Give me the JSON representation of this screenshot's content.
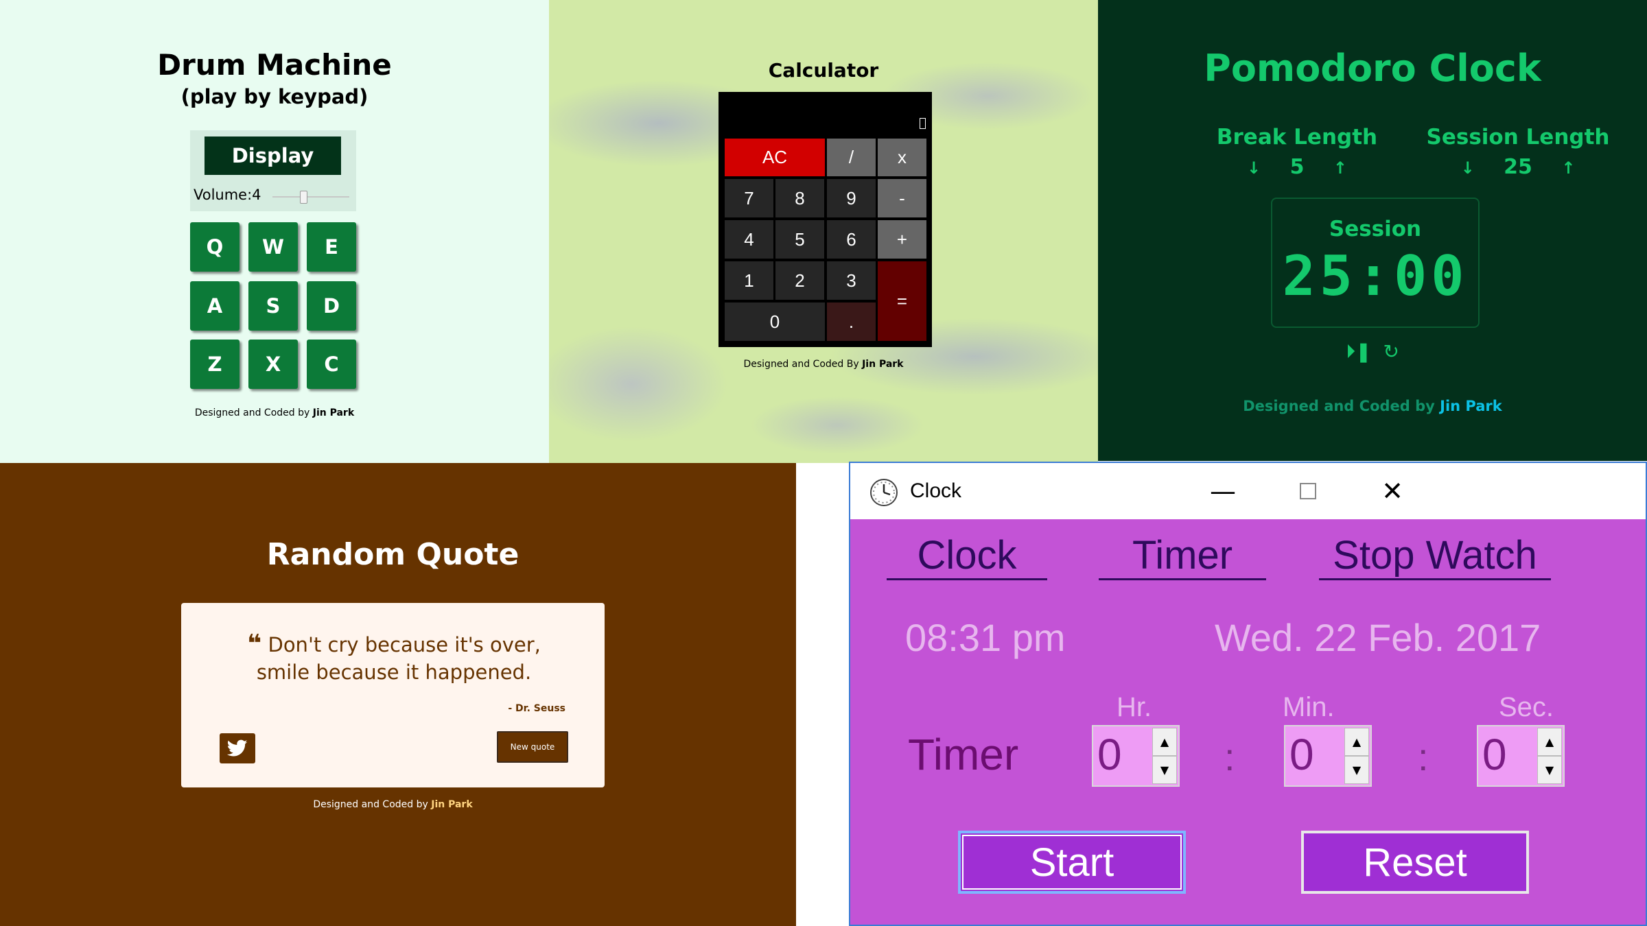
{
  "drum_machine": {
    "title": "Drum Machine",
    "subtitle": "(play by keypad)",
    "display_label": "Display",
    "volume_label": "Volume:4",
    "volume_level": 0.4,
    "pads": [
      "Q",
      "W",
      "E",
      "A",
      "S",
      "D",
      "Z",
      "X",
      "C"
    ],
    "credit_prefix": "Designed and Coded by",
    "credit_name": "Jin Park",
    "colors": {
      "background": "#e8fcf1",
      "pad": "#0c7a38",
      "display": "#033319"
    }
  },
  "calculator": {
    "title": "Calculator",
    "keys": {
      "ac": "AC",
      "divide": "/",
      "multiply": "x",
      "seven": "7",
      "eight": "8",
      "nine": "9",
      "minus": "-",
      "four": "4",
      "five": "5",
      "six": "6",
      "plus": "+",
      "one": "1",
      "two": "2",
      "three": "3",
      "equals": "=",
      "zero": "0",
      "decimal": "."
    },
    "credit_prefix": "Designed and Coded By",
    "credit_name": "Jin Park",
    "colors": {
      "ac": "#d20000",
      "operator": "#666666",
      "equals": "#620000",
      "digit": "#262626"
    }
  },
  "pomodoro": {
    "title": "Pomodoro Clock",
    "break_label": "Break Length",
    "break_value": "5",
    "session_label": "Session Length",
    "session_value": "25",
    "timer_label": "Session",
    "timer_value": "25:00",
    "down_icon": "arrow-down-icon",
    "up_icon": "arrow-up-icon",
    "credit_prefix": "Designed and Coded by",
    "credit_name": "Jin Park",
    "colors": {
      "background": "#03301b",
      "accent": "#14c96c"
    }
  },
  "random_quote": {
    "title": "Random Quote",
    "quote": "Don't cry because it's over, smile because it happened.",
    "author": "- Dr. Seuss",
    "new_quote_label": "New quote",
    "tweet_icon": "twitter-icon",
    "credit_prefix": "Designed and Coded by",
    "credit_name": "Jin Park",
    "colors": {
      "background": "#663300",
      "card": "#fff5ee"
    }
  },
  "clock_window": {
    "window_title": "Clock",
    "tabs": [
      "Clock",
      "Timer",
      "Stop Watch"
    ],
    "current_time": "08:31 pm",
    "current_date": "Wed. 22 Feb. 2017",
    "timer_label": "Timer",
    "units": {
      "hour": "Hr.",
      "minute": "Min.",
      "second": "Sec."
    },
    "values": {
      "hour": "0",
      "minute": "0",
      "second": "0"
    },
    "separator": ":",
    "start_label": "Start",
    "reset_label": "Reset",
    "colors": {
      "background": "#c353d6",
      "button": "#9f2fd4"
    }
  }
}
